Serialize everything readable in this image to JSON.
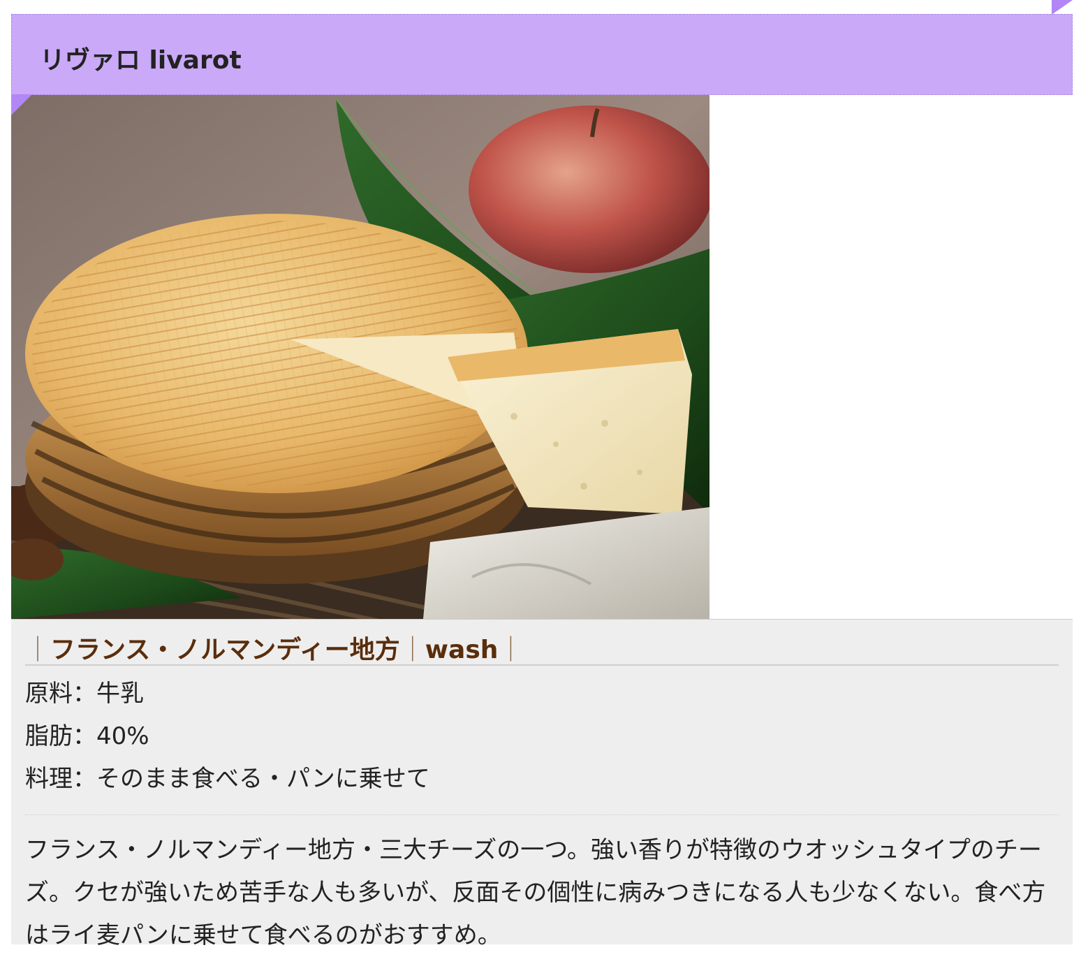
{
  "header": {
    "title": "リヴァロ livarot"
  },
  "photo": {
    "alt_icon": "cheese-photo"
  },
  "tags": {
    "bar_left": "｜",
    "region": "フランス・ノルマンディー地方",
    "bar_mid": "｜",
    "type": "wash",
    "bar_right": "｜"
  },
  "specs": [
    {
      "label": "原料",
      "sep": "：",
      "value": "牛乳"
    },
    {
      "label": "脂肪",
      "sep": "：",
      "value": "40%"
    },
    {
      "label": "料理",
      "sep": "：",
      "value": "そのまま食べる・パンに乗せて"
    }
  ],
  "description": "フランス・ノルマンディー地方・三大チーズの一つ。強い香りが特徴のウオッシュタイプのチーズ。クセが強いため苦手な人も多いが、反面その個性に病みつきになる人も少なくない。食べ方はライ麦パンに乗せて食べるのがおすすめ。",
  "colors": {
    "header_bg": "#caa9f8",
    "tag_text": "#5a2d0c",
    "info_bg": "#eeeeee"
  }
}
